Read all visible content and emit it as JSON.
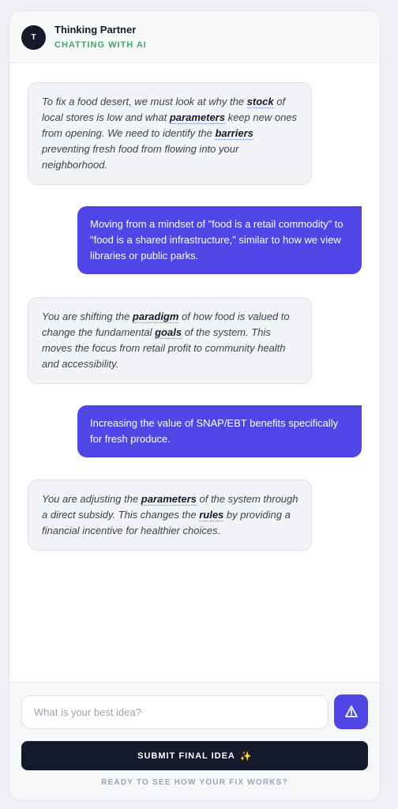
{
  "header": {
    "avatar_letter": "T",
    "title": "Thinking Partner",
    "subtitle": "CHATTING WITH AI"
  },
  "messages": [
    {
      "role": "ai",
      "segments": [
        {
          "text": "To fix a food desert, we must look at why the "
        },
        {
          "text": "stock",
          "keyword": true
        },
        {
          "text": " of local stores is low and what "
        },
        {
          "text": "parameters",
          "keyword": true
        },
        {
          "text": " keep new ones from opening. We need to identify the "
        },
        {
          "text": "barriers",
          "keyword": true
        },
        {
          "text": " preventing fresh food from flowing into your neighborhood."
        }
      ]
    },
    {
      "role": "user",
      "segments": [
        {
          "text": "Moving from a mindset of \"food is a retail commodity\" to \"food is a shared infrastructure,\" similar to how we view libraries or public parks."
        }
      ]
    },
    {
      "role": "ai",
      "segments": [
        {
          "text": "You are shifting the "
        },
        {
          "text": "paradigm",
          "keyword": true
        },
        {
          "text": " of how food is valued to change the fundamental "
        },
        {
          "text": "goals",
          "keyword": true
        },
        {
          "text": " of the system. This moves the focus from retail profit to community health and accessibility."
        }
      ]
    },
    {
      "role": "user",
      "segments": [
        {
          "text": "Increasing the value of SNAP/EBT benefits specifically for fresh produce."
        }
      ]
    },
    {
      "role": "ai",
      "segments": [
        {
          "text": "You are adjusting the "
        },
        {
          "text": "parameters",
          "keyword": true
        },
        {
          "text": " of the system through a direct subsidy. This changes the "
        },
        {
          "text": "rules",
          "keyword": true
        },
        {
          "text": " by providing a financial incentive for healthier choices."
        }
      ]
    }
  ],
  "composer": {
    "placeholder": "What is your best idea?",
    "value": "",
    "send_icon": "send-triangle-icon",
    "submit_label": "SUBMIT FINAL IDEA",
    "submit_icon": "✨",
    "hint": "READY TO SEE HOW YOUR FIX WORKS?"
  },
  "colors": {
    "accent": "#4f46e5",
    "dark": "#141a2b",
    "status_green": "#3fa56d",
    "ai_bubble": "#f2f4f8"
  }
}
